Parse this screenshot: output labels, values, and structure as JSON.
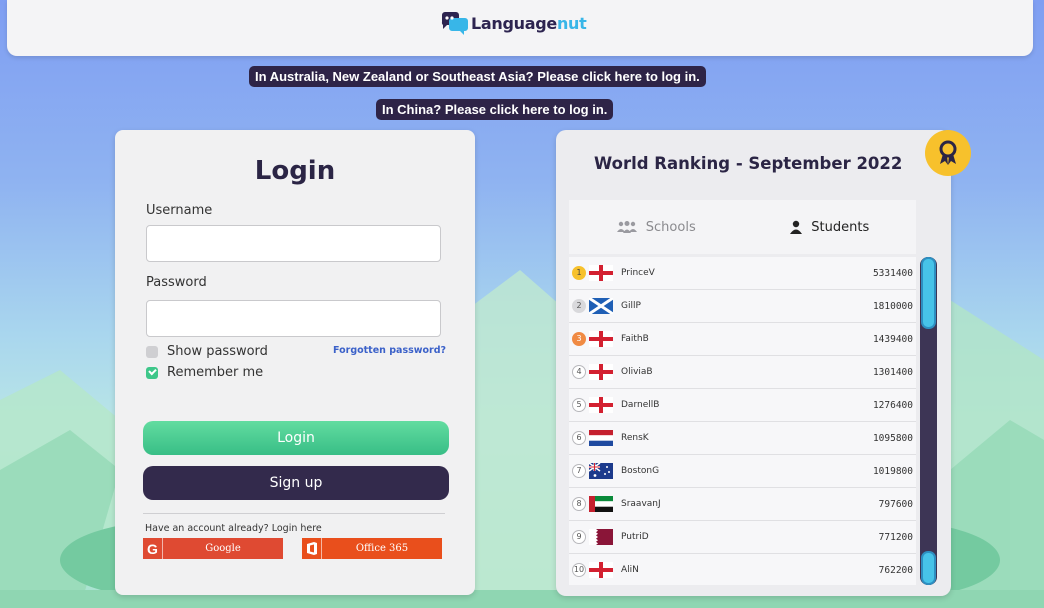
{
  "header": {
    "logo_text_a": "Language",
    "logo_text_b": "nut",
    "logo_icon": "chat-bubbles-logo-icon"
  },
  "banners": {
    "region_login": "In Australia, New Zealand or Southeast Asia? Please click here to log in.",
    "china_login": "In China? Please click here to log in."
  },
  "login": {
    "title": "Login",
    "username_label": "Username",
    "username_value": "",
    "password_label": "Password",
    "password_value": "",
    "show_password": {
      "label": "Show password",
      "checked": false
    },
    "remember_me": {
      "label": "Remember me",
      "checked": true
    },
    "forgot_link": "Forgotten password?",
    "login_button": "Login",
    "signup_button": "Sign up",
    "have_account_text": "Have an account already? Login here",
    "google_label": "Google",
    "google_icon_glyph": "G",
    "office_label": "Office 365",
    "colors": {
      "login_green": "#3ec78a",
      "signup_dark": "#332a4c",
      "google_red": "#df4a32",
      "office_orange": "#e94f1c"
    }
  },
  "ranking": {
    "title": "World Ranking - September 2022",
    "badge_icon": "award-ribbon-icon",
    "tabs": [
      {
        "label": "Schools",
        "icon": "group-icon",
        "active": false
      },
      {
        "label": "Students",
        "icon": "person-icon",
        "active": true
      }
    ],
    "rows": [
      {
        "rank": "1",
        "flag": "england",
        "name": "PrinceV",
        "score": "5331400"
      },
      {
        "rank": "2",
        "flag": "scotland",
        "name": "GillP",
        "score": "1810000"
      },
      {
        "rank": "3",
        "flag": "england",
        "name": "FaithB",
        "score": "1439400"
      },
      {
        "rank": "4",
        "flag": "england",
        "name": "OliviaB",
        "score": "1301400"
      },
      {
        "rank": "5",
        "flag": "england",
        "name": "DarnellB",
        "score": "1276400"
      },
      {
        "rank": "6",
        "flag": "netherlands",
        "name": "RensK",
        "score": "1095800"
      },
      {
        "rank": "7",
        "flag": "australia",
        "name": "BostonG",
        "score": "1019800"
      },
      {
        "rank": "8",
        "flag": "uae",
        "name": "SraavanJ",
        "score": "797600"
      },
      {
        "rank": "9",
        "flag": "qatar",
        "name": "PutriD",
        "score": "771200"
      },
      {
        "rank": "10",
        "flag": "england",
        "name": "AliN",
        "score": "762200"
      }
    ]
  }
}
